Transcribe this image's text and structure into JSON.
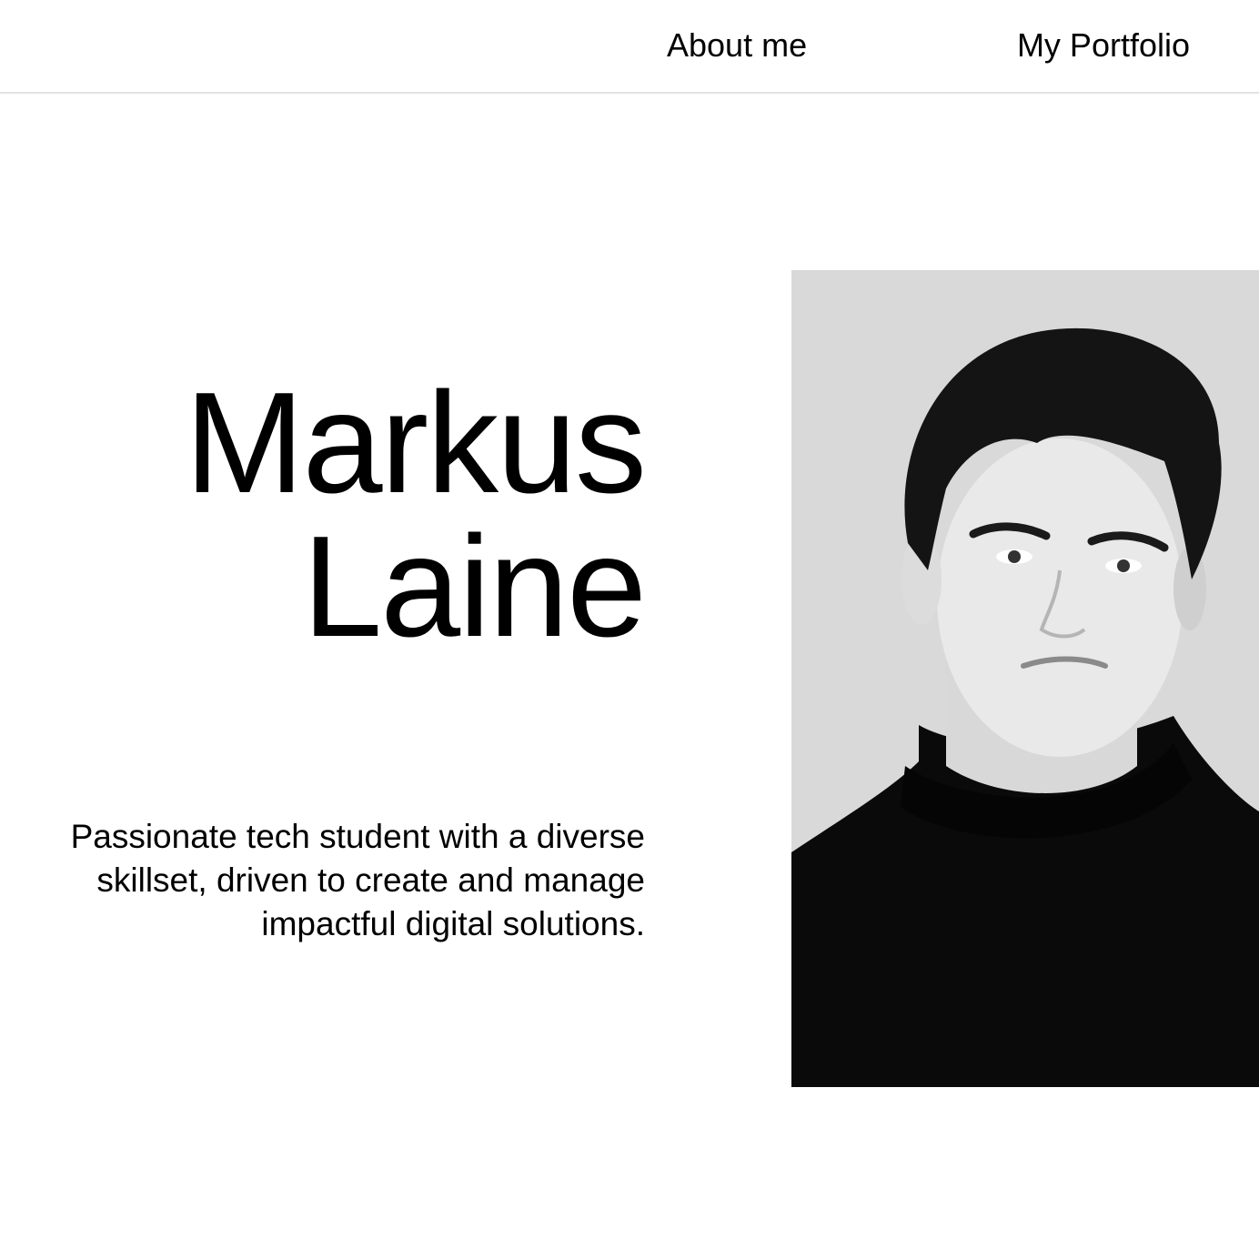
{
  "nav": {
    "about_label": "About me",
    "portfolio_label": "My Portfolio"
  },
  "hero": {
    "first_name": "Markus",
    "last_name": "Laine",
    "tagline": "Passionate tech student with a diverse skillset, driven to create and manage impactful digital solutions."
  },
  "colors": {
    "text": "#000000",
    "background": "#ffffff",
    "divider": "#e3e3e3",
    "photo_background": "#d9d9d9"
  }
}
